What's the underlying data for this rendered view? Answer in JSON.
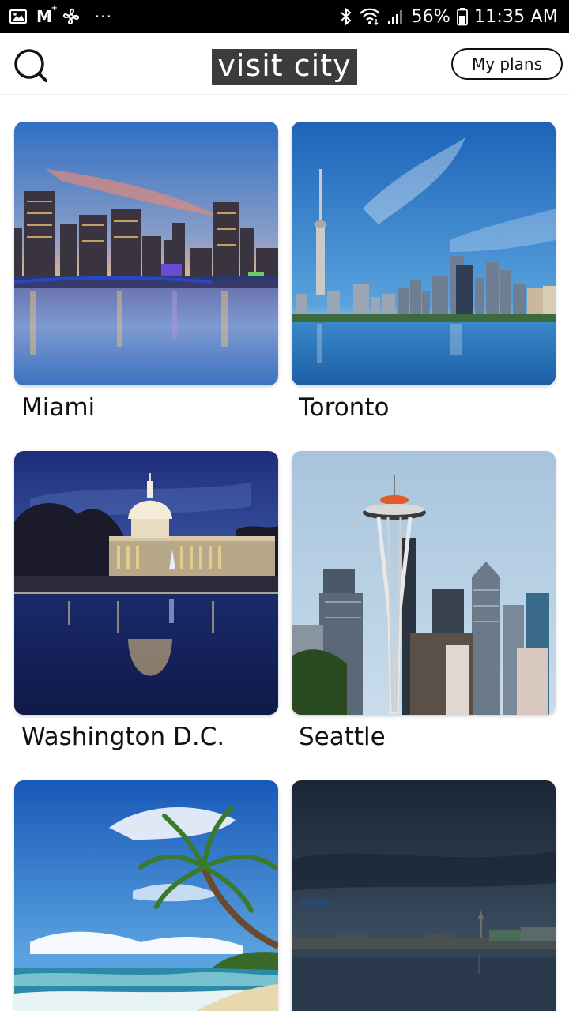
{
  "status_bar": {
    "battery": "56%",
    "time": "11:35 AM",
    "m_label": "M",
    "more_dots": "···",
    "icons": [
      "gallery-icon",
      "gmail-icon",
      "fan-icon",
      "bluetooth-icon",
      "wifi-icon",
      "signal-icon",
      "battery-icon"
    ]
  },
  "header": {
    "logo_text": "visit city",
    "my_plans_label": "My plans",
    "search_icon": "search-icon"
  },
  "cities": [
    {
      "name": "Miami"
    },
    {
      "name": "Toronto"
    },
    {
      "name": "Washington D.C."
    },
    {
      "name": "Seattle"
    },
    {
      "name": ""
    },
    {
      "name": ""
    }
  ],
  "colors": {
    "status_bar_bg": "#000000",
    "logo_bg": "#3c3c3c",
    "text": "#111111"
  }
}
